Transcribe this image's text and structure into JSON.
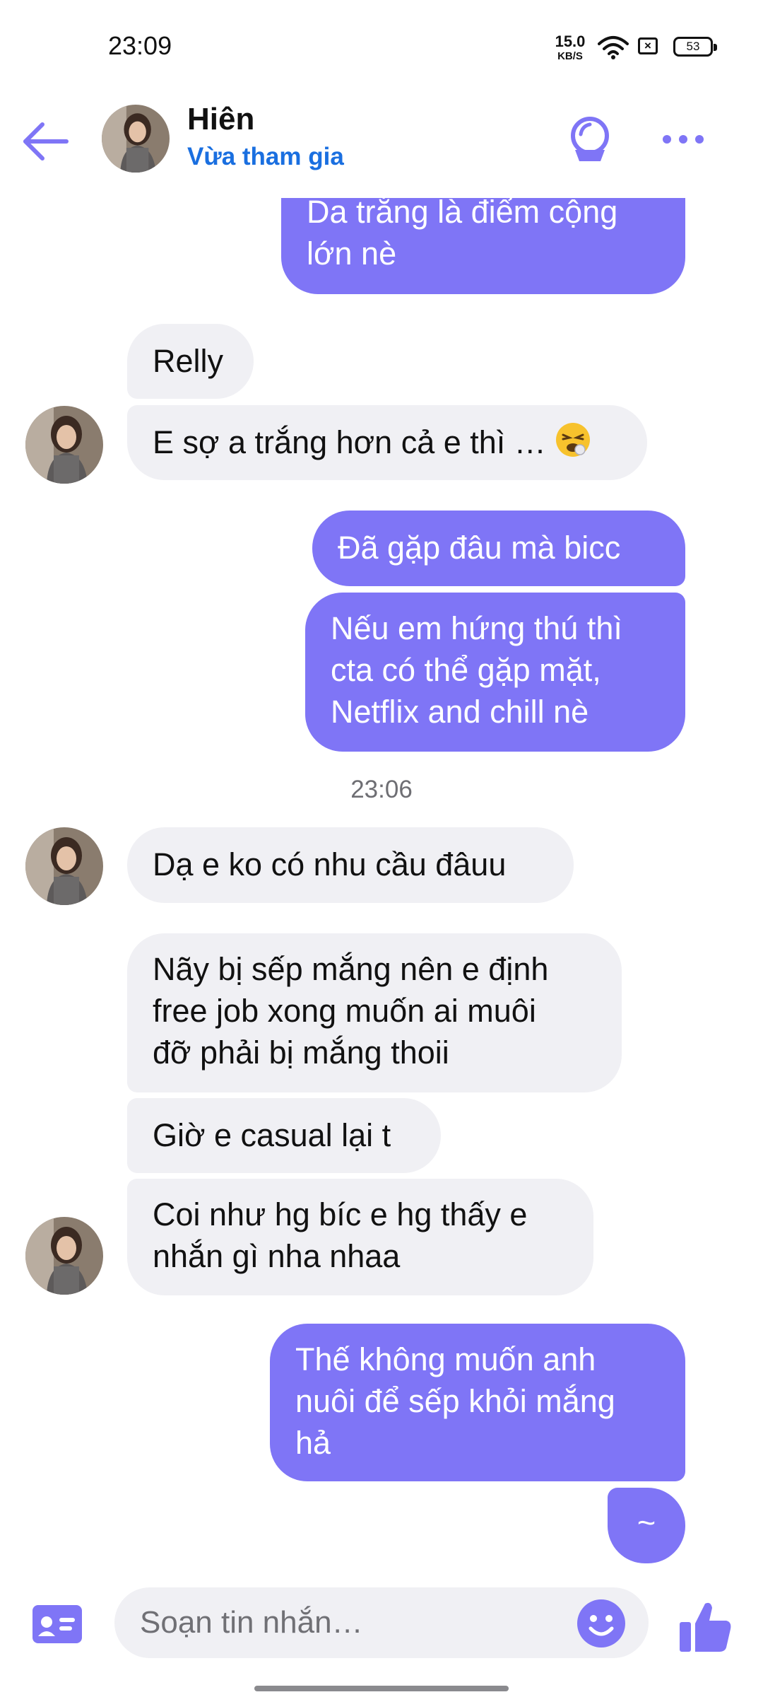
{
  "status_bar": {
    "time": "23:09",
    "net_speed_value": "15.0",
    "net_speed_unit": "KB/S",
    "battery": "53"
  },
  "header": {
    "contact_name": "Hiên",
    "contact_status": "Vừa tham gia",
    "icons": [
      "back-arrow-icon",
      "call-icon",
      "more-icon"
    ]
  },
  "messages": [
    {
      "from": "me",
      "text": "Da trắng là điểm cộng\nlớn nè"
    },
    {
      "from": "contact",
      "text": "Relly"
    },
    {
      "from": "contact",
      "text": "E sợ a trắng hơn cả e thì … ",
      "emoji": "😤"
    },
    {
      "from": "me",
      "text": "Đã gặp đâu mà bicc"
    },
    {
      "from": "me",
      "text": "Nếu em hứng thú thì\ncta có thể gặp mặt,\nNetflix and chill nè"
    },
    {
      "from": "contact",
      "text": "Dạ e ko có nhu cầu đâuu"
    },
    {
      "from": "contact",
      "text": "Nãy bị sếp mắng nên e định\nfree job xong muốn ai muôi\nđỡ phải bị mắng thoii"
    },
    {
      "from": "contact",
      "text": "Giờ e casual lại t"
    },
    {
      "from": "contact",
      "text": "Coi như hg bíc e hg thấy e\nnhắn gì nha nhaa"
    },
    {
      "from": "me",
      "text": "Thế không muốn anh\nnuôi để sếp khỏi mắng\nhả"
    },
    {
      "from": "me",
      "text": "~"
    }
  ],
  "timestamp": "23:06",
  "composer": {
    "placeholder": "Soạn tin nhắn…"
  },
  "colors": {
    "accent": "#7f75f6",
    "incoming_bubble": "#f0f0f4",
    "status_link": "#1a6fe0"
  }
}
